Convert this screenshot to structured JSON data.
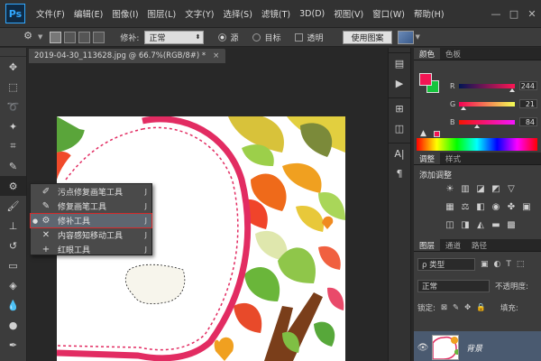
{
  "app": {
    "logo": "Ps",
    "menu": [
      "文件(F)",
      "编辑(E)",
      "图像(I)",
      "图层(L)",
      "文字(Y)",
      "选择(S)",
      "滤镜(T)",
      "3D(D)",
      "视图(V)",
      "窗口(W)",
      "帮助(H)"
    ],
    "window_controls": [
      "—",
      "□",
      "✕"
    ]
  },
  "options_bar": {
    "patch_label": "修补:",
    "patch_value": "正常",
    "source_label": "源",
    "destination_label": "目标",
    "transparent_label": "透明",
    "use_pattern_button": "使用图案"
  },
  "document": {
    "tab_title": "2019-04-30_113628.jpg @ 66.7%(RGB/8#) *",
    "tab_close": "×"
  },
  "flyout": {
    "items": [
      {
        "label": "污点修复画笔工具",
        "key": "J",
        "selected": false,
        "icon": "spot-healing-icon"
      },
      {
        "label": "修复画笔工具",
        "key": "J",
        "selected": false,
        "icon": "healing-brush-icon"
      },
      {
        "label": "修补工具",
        "key": "J",
        "selected": true,
        "icon": "patch-icon"
      },
      {
        "label": "内容感知移动工具",
        "key": "J",
        "selected": false,
        "icon": "content-aware-move-icon"
      },
      {
        "label": "红眼工具",
        "key": "J",
        "selected": false,
        "icon": "red-eye-icon"
      }
    ]
  },
  "color_panel": {
    "tabs": [
      "颜色",
      "色板"
    ],
    "active_tab": "颜色",
    "foreground": "#f41554",
    "background": "#15c43c",
    "channels": [
      {
        "label": "R",
        "value": "244",
        "fraction": 0.957
      },
      {
        "label": "G",
        "value": "21",
        "fraction": 0.082
      },
      {
        "label": "B",
        "value": "84",
        "fraction": 0.329
      }
    ]
  },
  "adjustments_panel": {
    "tabs": [
      "调整",
      "样式"
    ],
    "active_tab": "调整",
    "title": "添加调整"
  },
  "layers_panel": {
    "tabs": [
      "图层",
      "通道",
      "路径"
    ],
    "active_tab": "图层",
    "filter_label": "ρ 类型",
    "blend_mode": "正常",
    "opacity_label": "不透明度:",
    "lock_label": "锁定:",
    "fill_label": "填充:",
    "layer_name": "背景"
  }
}
